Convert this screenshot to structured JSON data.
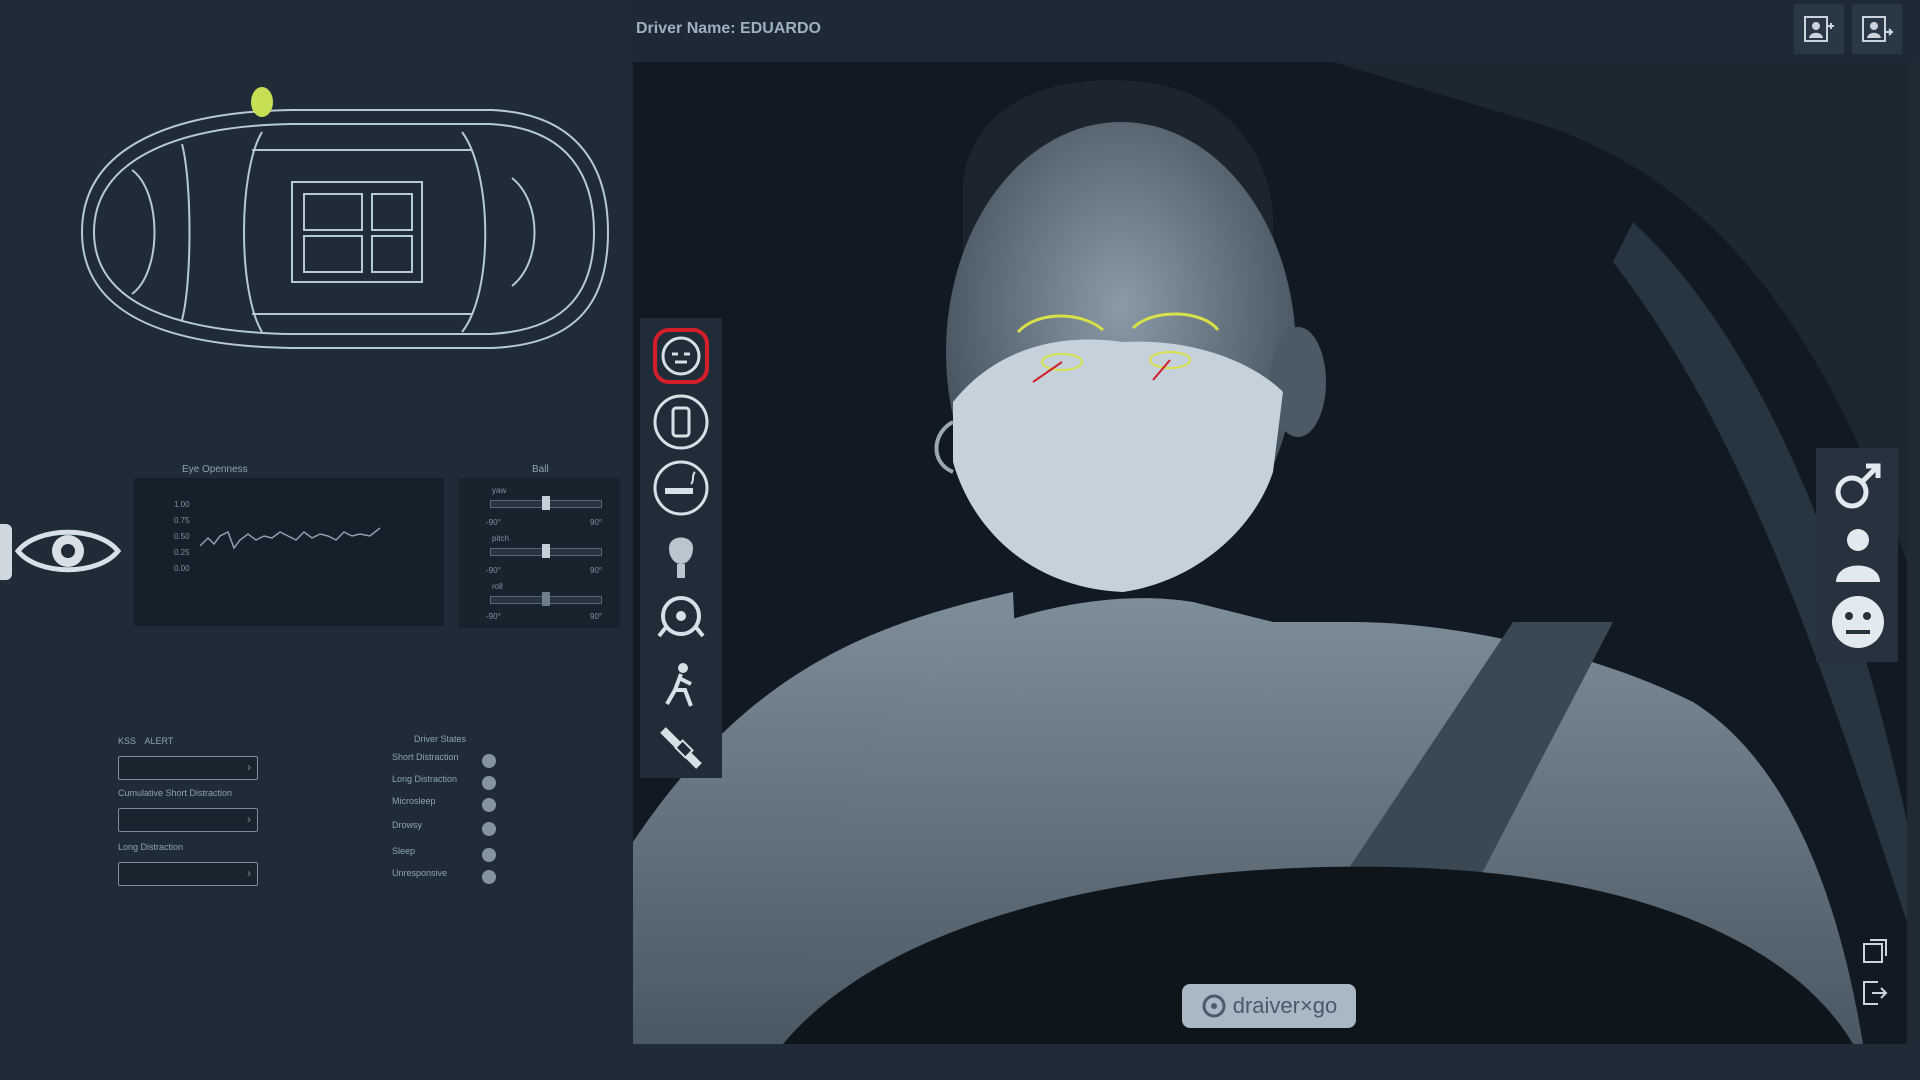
{
  "header": {
    "driver_name": "Driver Name: EDUARDO"
  },
  "top_buttons": [
    {
      "icon": "add-user-icon"
    },
    {
      "icon": "switch-user-icon"
    }
  ],
  "camera_controls": [
    {
      "icon": "refresh-icon"
    },
    {
      "icon": "screen-record-icon"
    },
    {
      "icon": "settings-gear-icon"
    },
    {
      "icon": "record-dot-icon",
      "color": "#d21f2b"
    },
    {
      "icon": "volume-icon"
    }
  ],
  "behavior_icons": [
    {
      "icon": "drowsy-face-icon",
      "active": true,
      "accent": "#d21f2b"
    },
    {
      "icon": "phone-use-icon"
    },
    {
      "icon": "smoking-icon"
    },
    {
      "icon": "eating-icon"
    },
    {
      "icon": "hands-on-wheel-icon"
    },
    {
      "icon": "seatbelt-person-icon"
    },
    {
      "icon": "seatbelt-buckle-icon"
    }
  ],
  "driver_attributes": [
    {
      "icon": "male-gender-icon"
    },
    {
      "icon": "driver-profile-icon"
    },
    {
      "icon": "neutral-emotion-icon"
    }
  ],
  "eye_openness": {
    "title": "Eye Openness",
    "y_ticks": [
      "1.00",
      "0.75",
      "0.50",
      "0.25",
      "0.00"
    ]
  },
  "gauges": {
    "title": "Ball",
    "rows": [
      {
        "label": "yaw",
        "min": "-90°",
        "max": "90°",
        "value": 0.5
      },
      {
        "label": "pitch",
        "min": "-90°",
        "max": "90°",
        "value": 0.5
      },
      {
        "label": "roll",
        "min": "-90°",
        "max": "90°",
        "value": 0.5
      }
    ]
  },
  "kss": {
    "kss_label": "KSS",
    "kss_value": "ALERT",
    "cumulative_label": "Cumulative Short Distraction",
    "long_label": "Long Distraction"
  },
  "driver_states": {
    "title": "Driver States",
    "items": [
      "Short Distraction",
      "Long Distraction",
      "Microsleep",
      "Drowsy",
      "Sleep",
      "Unresponsive"
    ]
  },
  "brand": {
    "name": "draiver×go"
  },
  "colors": {
    "accent_green": "#c6df55",
    "accent_red": "#d21f2b",
    "panel": "#1f2b36"
  }
}
